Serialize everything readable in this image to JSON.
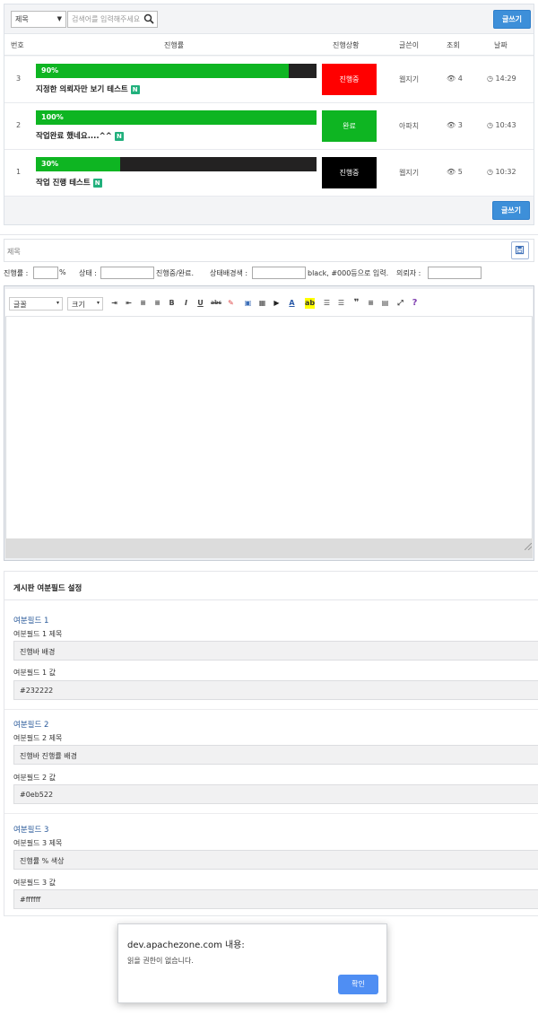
{
  "list": {
    "select_value": "제목",
    "search_placeholder": "검색어를 입력해주세요",
    "write_label": "글쓰기",
    "columns": [
      "번호",
      "진행률",
      "진행상황",
      "글쓴이",
      "조회",
      "날짜"
    ],
    "rows": [
      {
        "num": "3",
        "progress_text": "90%",
        "progress": 0.9,
        "title": "지정한 의뢰자만 보기 테스트",
        "badge": "N",
        "status": "진행중",
        "status_color": "#ff0000",
        "author": "웹지기",
        "views": "4",
        "date": "14:29"
      },
      {
        "num": "2",
        "progress_text": "100%",
        "progress": 1.0,
        "title": "작업완료 했네요....^^",
        "badge": "N",
        "status": "완료",
        "status_color": "#0eb522",
        "author": "아파치",
        "views": "3",
        "date": "10:43"
      },
      {
        "num": "1",
        "progress_text": "30%",
        "progress": 0.3,
        "title": "작업 진행 테스트",
        "badge": "N",
        "status": "진행중",
        "status_color": "#000000",
        "author": "웹지기",
        "views": "5",
        "date": "10:32"
      }
    ],
    "bar_bg": "#232222",
    "bar_fill": "#0eb522"
  },
  "form": {
    "subject_placeholder": "제목",
    "progress_label": "진행률 :",
    "percent": "%",
    "state_label": "상태 :",
    "state_hint": "진행중/완료.",
    "status_bg_label": "상태배경색 :",
    "status_bg_hint": "black, #000등으로 입력.",
    "client_label": "의뢰자 :",
    "font_dd": "글꼴",
    "size_dd": "크기",
    "save_icon": "floppy-icon"
  },
  "extra": {
    "header": "게시판 여분필드 설정",
    "fields": [
      {
        "group": "여분필드 1",
        "title_label": "여분필드 1 제목",
        "title_value": "진행바 배경",
        "value_label": "여분필드 1 값",
        "value": "#232222"
      },
      {
        "group": "여분필드 2",
        "title_label": "여분필드 2 제목",
        "title_value": "진행바 진행률 배경",
        "value_label": "여분필드 2 값",
        "value": "#0eb522"
      },
      {
        "group": "여분필드 3",
        "title_label": "여분필드 3 제목",
        "title_value": "진행률 % 색상",
        "value_label": "여분필드 3 값",
        "value": "#ffffff"
      }
    ]
  },
  "dialog": {
    "title": "dev.apachezone.com 내용:",
    "message": "읽을 권한이 없습니다.",
    "ok": "확인"
  }
}
